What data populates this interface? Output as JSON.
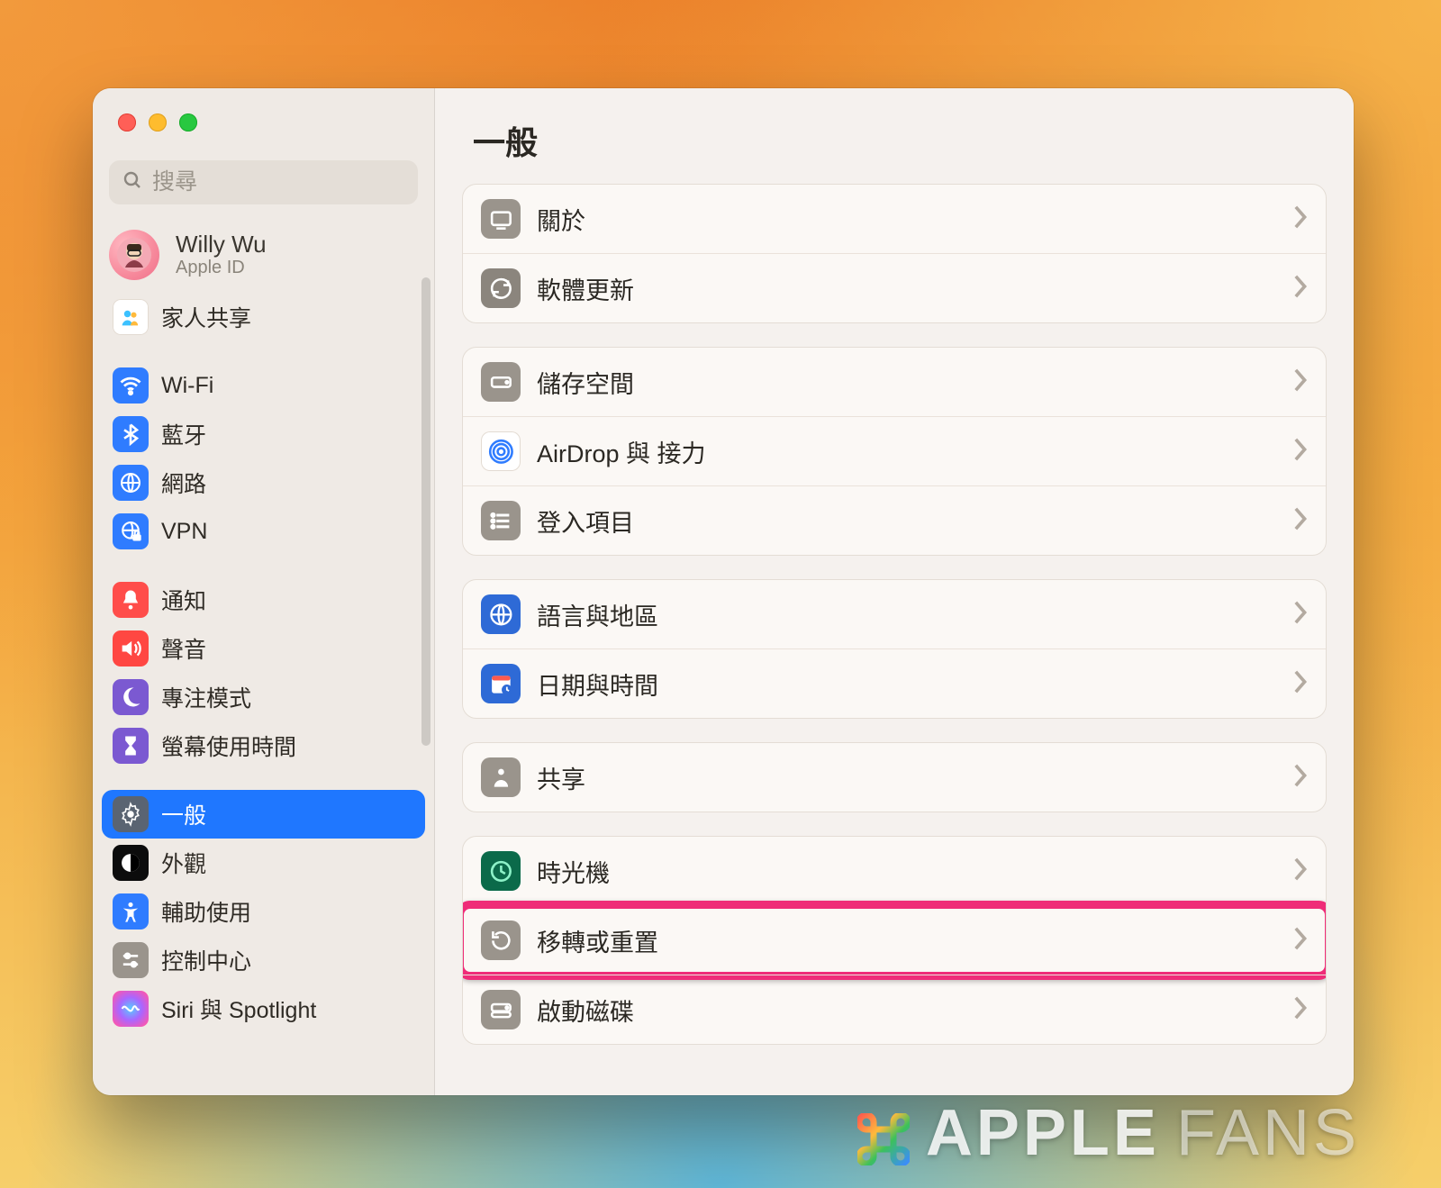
{
  "window": {
    "title": "一般"
  },
  "search": {
    "placeholder": "搜尋"
  },
  "profile": {
    "name": "Willy Wu",
    "sub": "Apple ID"
  },
  "sidebar": {
    "items": [
      {
        "id": "family",
        "label": "家人共享",
        "icon": "family-icon"
      },
      {
        "id": "wifi",
        "label": "Wi-Fi",
        "icon": "wifi-icon"
      },
      {
        "id": "bt",
        "label": "藍牙",
        "icon": "bluetooth-icon"
      },
      {
        "id": "network",
        "label": "網路",
        "icon": "globe-icon"
      },
      {
        "id": "vpn",
        "label": "VPN",
        "icon": "globe-lock-icon"
      },
      {
        "id": "notif",
        "label": "通知",
        "icon": "bell-icon"
      },
      {
        "id": "sound",
        "label": "聲音",
        "icon": "speaker-icon"
      },
      {
        "id": "focus",
        "label": "專注模式",
        "icon": "moon-icon"
      },
      {
        "id": "screen",
        "label": "螢幕使用時間",
        "icon": "hourglass-icon"
      },
      {
        "id": "general",
        "label": "一般",
        "icon": "gear-icon",
        "selected": true
      },
      {
        "id": "appear",
        "label": "外觀",
        "icon": "contrast-icon"
      },
      {
        "id": "access",
        "label": "輔助使用",
        "icon": "accessibility-icon"
      },
      {
        "id": "control",
        "label": "控制中心",
        "icon": "sliders-icon"
      },
      {
        "id": "siri",
        "label": "Siri 與 Spotlight",
        "icon": "siri-icon"
      }
    ]
  },
  "content": {
    "groups": [
      {
        "rows": [
          {
            "id": "about",
            "label": "關於",
            "icon": "about-icon"
          },
          {
            "id": "update",
            "label": "軟體更新",
            "icon": "update-icon"
          }
        ]
      },
      {
        "rows": [
          {
            "id": "storage",
            "label": "儲存空間",
            "icon": "disk-icon"
          },
          {
            "id": "airdrop",
            "label": "AirDrop 與 接力",
            "icon": "airdrop-icon"
          },
          {
            "id": "login",
            "label": "登入項目",
            "icon": "list-icon"
          }
        ]
      },
      {
        "rows": [
          {
            "id": "lang",
            "label": "語言與地區",
            "icon": "globe-blue-icon"
          },
          {
            "id": "date",
            "label": "日期與時間",
            "icon": "calendar-icon"
          }
        ]
      },
      {
        "rows": [
          {
            "id": "share",
            "label": "共享",
            "icon": "share-icon"
          }
        ]
      },
      {
        "rows": [
          {
            "id": "tm",
            "label": "時光機",
            "icon": "timemachine-icon"
          },
          {
            "id": "migrate",
            "label": "移轉或重置",
            "icon": "reset-icon",
            "highlight": true
          },
          {
            "id": "startup",
            "label": "啟動磁碟",
            "icon": "startup-icon"
          }
        ]
      }
    ]
  },
  "watermark": {
    "brand": "APPLE",
    "tail": "FANS"
  },
  "colors": {
    "highlight": "#ef2c78",
    "selection": "#1f77ff"
  }
}
